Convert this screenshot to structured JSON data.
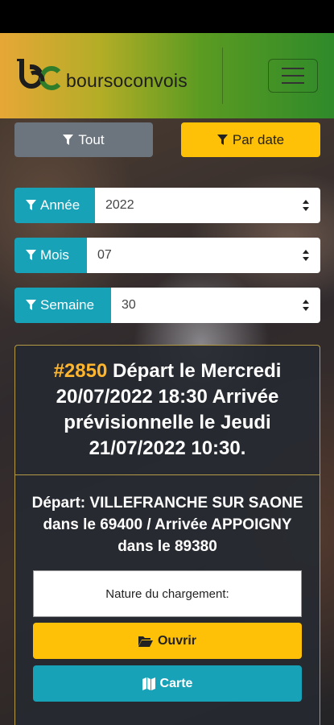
{
  "header": {
    "brand": "boursoconvois",
    "logo_icon": "bc-logo-icon",
    "menu_icon": "hamburger-icon"
  },
  "filters": {
    "tout_label": "Tout",
    "par_date_label": "Par date",
    "annee_label": "Année",
    "annee_value": "2022",
    "mois_label": "Mois",
    "mois_value": "07",
    "semaine_label": "Semaine",
    "semaine_value": "30"
  },
  "card": {
    "number": "#2850",
    "title": "Départ le Mercredi 20/07/2022 18:30 Arrivée prévisionnelle le Jeudi 21/07/2022 10:30.",
    "route": "Départ: VILLEFRANCHE SUR SAONE dans le 69400 / Arrivée APPOIGNY dans le 89380",
    "nature_label": "Nature du chargement:",
    "ouvrir_label": "Ouvrir",
    "carte_label": "Carte"
  },
  "colors": {
    "accent_yellow": "#ffc107",
    "accent_teal": "#17a2b8",
    "secondary_gray": "#6c757d",
    "number_orange": "#ffb52e"
  }
}
